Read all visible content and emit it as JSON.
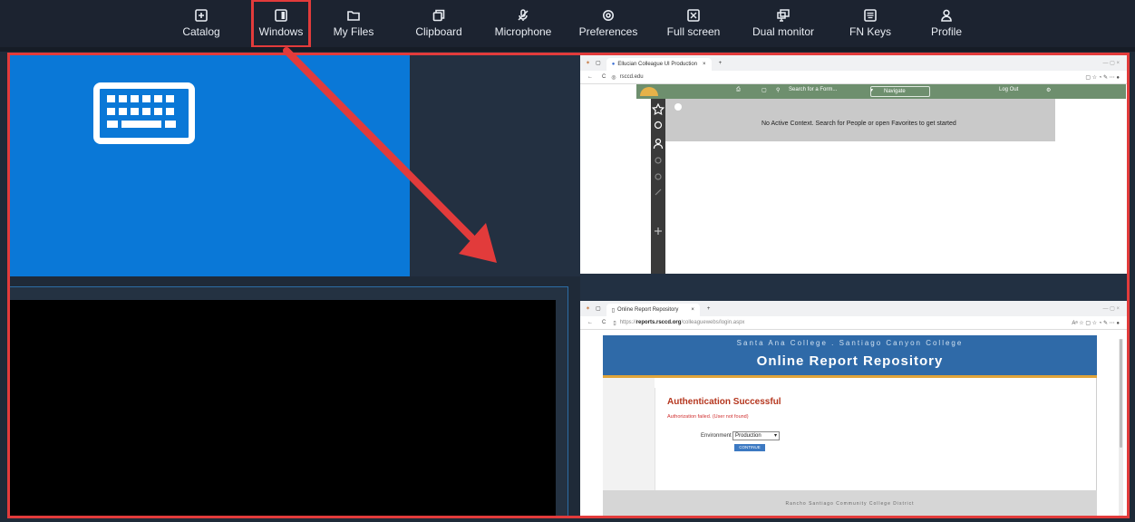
{
  "toolbar": {
    "items": [
      {
        "label": "Catalog",
        "icon": "plus-box-icon"
      },
      {
        "label": "Windows",
        "icon": "window-icon"
      },
      {
        "label": "My Files",
        "icon": "folder-icon"
      },
      {
        "label": "Clipboard",
        "icon": "clipboard-icon"
      },
      {
        "label": "Microphone",
        "icon": "microphone-off-icon"
      },
      {
        "label": "Preferences",
        "icon": "gear-icon"
      },
      {
        "label": "Full screen",
        "icon": "fullscreen-icon"
      },
      {
        "label": "Dual monitor",
        "icon": "dual-monitor-icon"
      },
      {
        "label": "FN Keys",
        "icon": "keyboard-icon"
      },
      {
        "label": "Profile",
        "icon": "person-icon"
      }
    ],
    "active_item": "Windows"
  },
  "highlight_color": "#e23b3b",
  "browser_top": {
    "tab_title": "Ellucian Colleague UI Production",
    "url": "rsccd.edu",
    "search_placeholder": "Search for a Form...",
    "navigate_label": "Navigate",
    "logout_label": "Log Out",
    "context_message": "No Active Context. Search for People or open Favorites to get started"
  },
  "browser_bottom": {
    "tab_title": "Online Report Repository",
    "url_prefix": "https://",
    "url_domain": "reports.rsccd.org",
    "url_path": "/colleaguewebs/login.aspx",
    "banner_subtitle": "Santa Ana College . Santiago Canyon College",
    "banner_title": "Online Report Repository",
    "auth_heading": "Authentication Successful",
    "auth_error": "Authorization failed. (User not found)",
    "environment_label": "Environment",
    "environment_value": "Production",
    "continue_label": "CONTINUE",
    "footer_text": "Rancho Santiago Community College District"
  },
  "colors": {
    "keyboard_pane": "#0a78d7",
    "toolbar_bg": "#1c2330",
    "app_green": "#6e8f6e",
    "banner_blue": "#2f6aa8"
  }
}
